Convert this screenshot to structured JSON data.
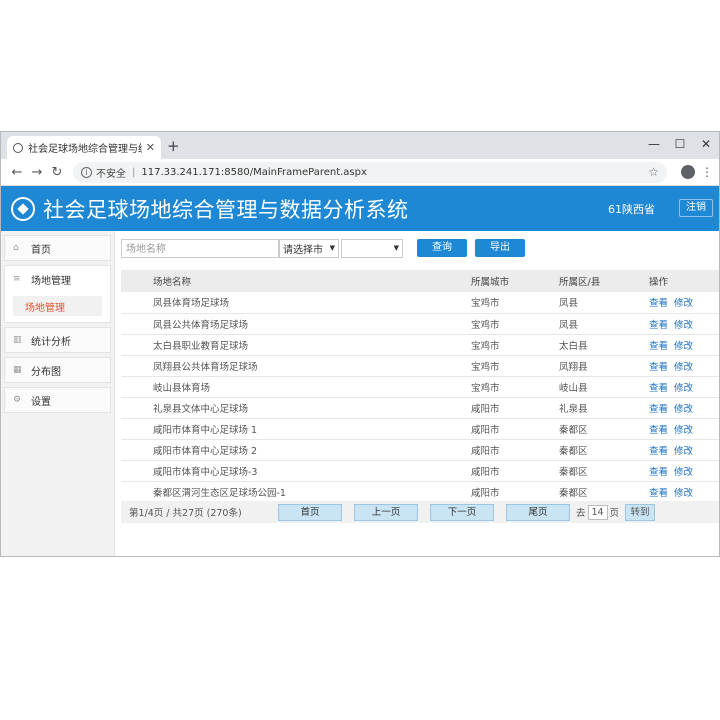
{
  "browser": {
    "tab_title": "社会足球场地综合管理与统计分析",
    "url_security": "不安全",
    "url": "117.33.241.171:8580/MainFrameParent.aspx"
  },
  "app": {
    "title": "社会足球场地综合管理与数据分析系统",
    "user": "61陕西省",
    "logout": "注销"
  },
  "sidebar": {
    "home": "首页",
    "venue_group": "场地管理",
    "venue_sub": "场地管理",
    "stats": "统计分析",
    "distribution": "分布图",
    "settings": "设置"
  },
  "toolbar": {
    "search_placeholder": "场地名称",
    "city_select": "请选择市",
    "district_select": "",
    "query": "查询",
    "export": "导出"
  },
  "table": {
    "headers": [
      "场地名称",
      "所属城市",
      "所属区/县",
      "操作"
    ],
    "op_view": "查看",
    "op_edit": "修改",
    "rows": [
      [
        "凤县体育场足球场",
        "宝鸡市",
        "凤县"
      ],
      [
        "凤县公共体育场足球场",
        "宝鸡市",
        "凤县"
      ],
      [
        "太白县职业教育足球场",
        "宝鸡市",
        "太白县"
      ],
      [
        "凤翔县公共体育场足球场",
        "宝鸡市",
        "凤翔县"
      ],
      [
        "岐山县体育场",
        "宝鸡市",
        "岐山县"
      ],
      [
        "礼泉县文体中心足球场",
        "咸阳市",
        "礼泉县"
      ],
      [
        "咸阳市体育中心足球场 1",
        "咸阳市",
        "秦都区"
      ],
      [
        "咸阳市体育中心足球场 2",
        "咸阳市",
        "秦都区"
      ],
      [
        "咸阳市体育中心足球场-3",
        "咸阳市",
        "秦都区"
      ],
      [
        "秦都区渭河生态区足球场公园-1",
        "咸阳市",
        "秦都区"
      ]
    ]
  },
  "pager": {
    "info": "第1/4页  /  共27页  (270条)",
    "first": "首页",
    "prev": "上一页",
    "next": "下一页",
    "last": "尾页",
    "goto_prefix": "去",
    "goto_page": "14",
    "goto_suffix": "页",
    "goto_button": "转到"
  }
}
